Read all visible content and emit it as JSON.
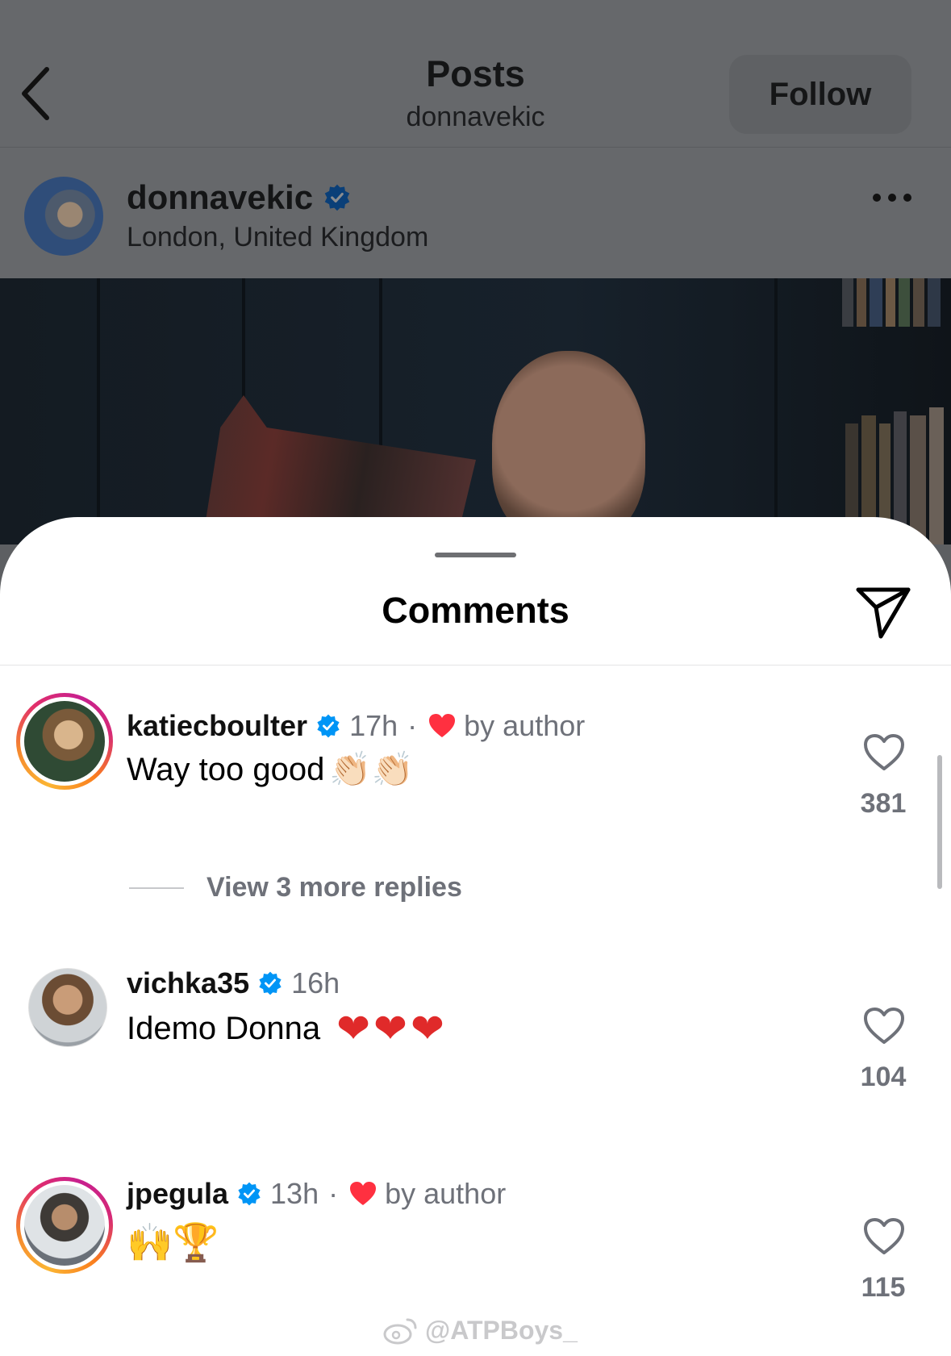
{
  "header": {
    "title": "Posts",
    "subtitle": "donnavekic",
    "follow_label": "Follow"
  },
  "post": {
    "author": "donnavekic",
    "location": "London, United Kingdom"
  },
  "sheet": {
    "title": "Comments"
  },
  "comments": [
    {
      "username": "katiecboulter",
      "time": "17h",
      "separator": "·",
      "author_liked": true,
      "author_label": "by author",
      "text": "Way too good",
      "emoji": "👏🏻👏🏻",
      "likes": "381",
      "story_ring": true
    },
    {
      "username": "vichka35",
      "time": "16h",
      "author_liked": false,
      "text": "Idemo Donna",
      "emoji": "❤❤❤",
      "likes": "104",
      "story_ring": false
    },
    {
      "username": "jpegula",
      "time": "13h",
      "separator": "·",
      "author_liked": true,
      "author_label": "by author",
      "text": "",
      "emoji": "🙌🏆",
      "likes": "115",
      "story_ring": true
    }
  ],
  "replies": {
    "label": "View 3 more replies"
  },
  "watermark": {
    "text": "@ATPBoys_"
  },
  "colors": {
    "verified_blue": "#0095f6",
    "heart_red": "#ff3040",
    "secondary_text": "#6e7179"
  },
  "icons": [
    "back-arrow-icon",
    "verified-badge-icon",
    "more-options-icon",
    "share-send-icon",
    "heart-outline-icon",
    "heart-filled-icon",
    "weibo-icon"
  ]
}
